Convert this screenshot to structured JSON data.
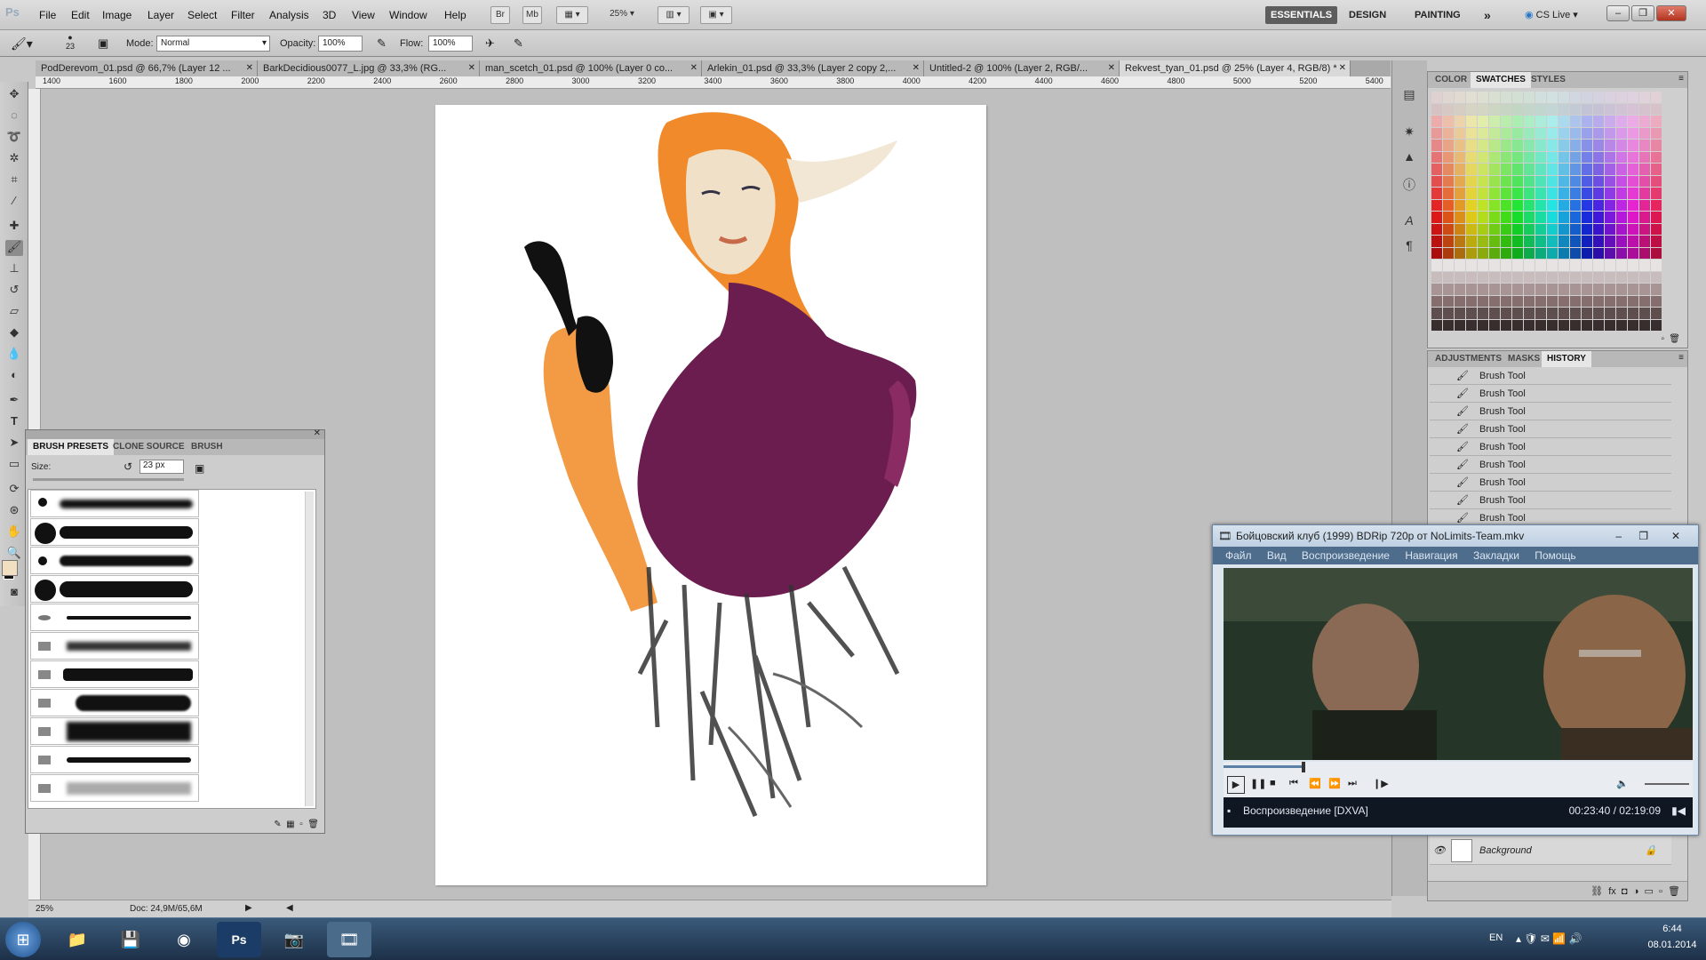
{
  "menubar": {
    "logo": "Ps",
    "items": [
      "File",
      "Edit",
      "Image",
      "Layer",
      "Select",
      "Filter",
      "Analysis",
      "3D",
      "View",
      "Window",
      "Help"
    ],
    "bridge_btn": "Br",
    "minibridge_btn": "Mb",
    "zoom": "25%",
    "workspaces": [
      "ESSENTIALS",
      "DESIGN",
      "PAINTING"
    ],
    "more": "»",
    "cslive": "CS Live",
    "win_min": "–",
    "win_max": "❐",
    "win_close": "✕"
  },
  "options": {
    "brush_size": "23",
    "mode_label": "Mode:",
    "mode_value": "Normal",
    "opacity_label": "Opacity:",
    "opacity_value": "100%",
    "flow_label": "Flow:",
    "flow_value": "100%"
  },
  "tabs": [
    {
      "label": "PodDerevom_01.psd @ 66,7% (Layer 12 ..."
    },
    {
      "label": "BarkDecidious0077_L.jpg @ 33,3% (RG..."
    },
    {
      "label": "man_scetch_01.psd @ 100% (Layer 0 co..."
    },
    {
      "label": "Arlekin_01.psd @ 33,3% (Layer 2 copy 2,..."
    },
    {
      "label": "Untitled-2 @ 100% (Layer 2, RGB/..."
    },
    {
      "label": "Rekvest_tyan_01.psd @ 25% (Layer 4, RGB/8) *"
    }
  ],
  "ruler_marks": [
    "1400",
    "1600",
    "1800",
    "2000",
    "2200",
    "2400",
    "2600",
    "2800",
    "3000",
    "3200",
    "3400",
    "3600",
    "3800",
    "4000",
    "4200",
    "4400",
    "4600",
    "4800",
    "5000",
    "5200",
    "5400"
  ],
  "status": {
    "zoom": "25%",
    "doc": "Doc: 24,9M/65,6M"
  },
  "swatches_panel": {
    "tabs": [
      "COLOR",
      "SWATCHES",
      "STYLES"
    ]
  },
  "history_panel": {
    "tabs": [
      "ADJUSTMENTS",
      "MASKS",
      "HISTORY"
    ],
    "items": [
      "Brush Tool",
      "Brush Tool",
      "Brush Tool",
      "Brush Tool",
      "Brush Tool",
      "Brush Tool",
      "Brush Tool",
      "Brush Tool",
      "Brush Tool"
    ],
    "background_layer": "Background"
  },
  "brush_panel": {
    "tabs": [
      "BRUSH PRESETS",
      "CLONE SOURCE",
      "BRUSH"
    ],
    "size_label": "Size:",
    "size_value": "23 px"
  },
  "video_player": {
    "title": "Бойцовский клуб (1999) BDRip 720p от NoLimits-Team.mkv",
    "menu": [
      "Файл",
      "Вид",
      "Воспроизведение",
      "Навигация",
      "Закладки",
      "Помощь"
    ],
    "status": "Воспроизведение [DXVA]",
    "time": "00:23:40 / 02:19:09",
    "progress": 0.17
  },
  "taskbar": {
    "lang": "EN",
    "time": "6:44",
    "date": "08.01.2014"
  }
}
